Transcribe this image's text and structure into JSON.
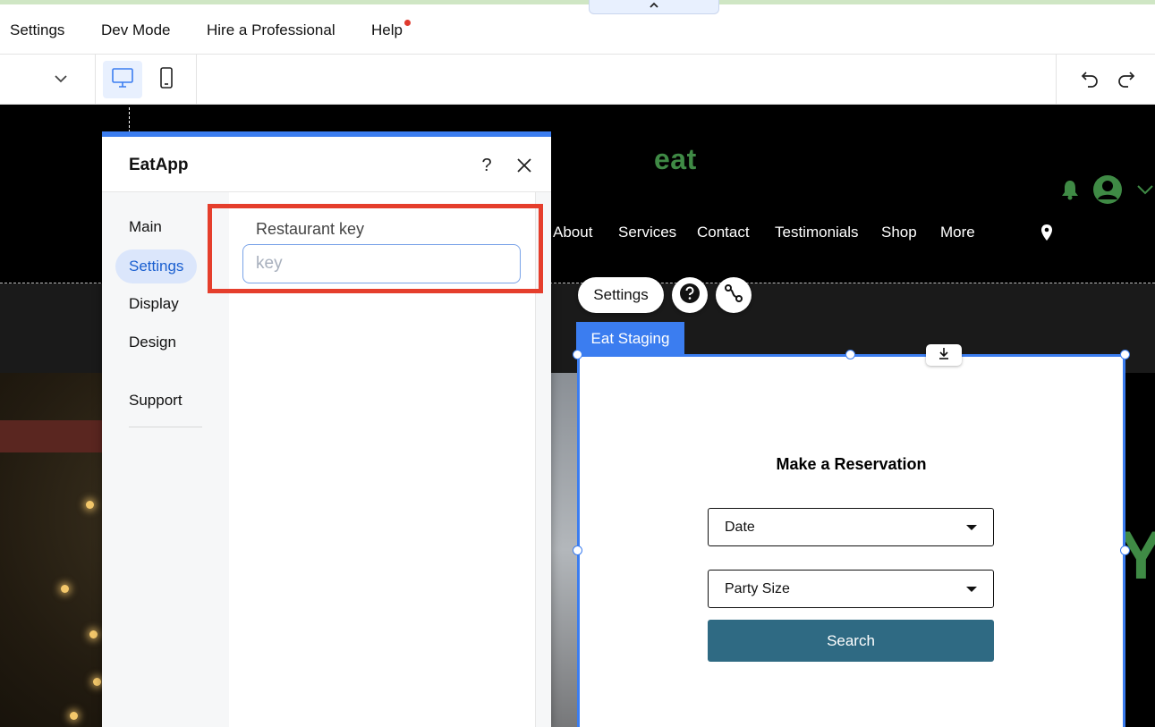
{
  "menubar": {
    "items": [
      "Settings",
      "Dev Mode",
      "Hire a Professional",
      "Help"
    ],
    "help_notification": true
  },
  "collapse_tab": {
    "icon": "chevron-up-icon",
    "glyph": "⌃"
  },
  "toolbar": {
    "dropdown_icon": "chevron-down-icon",
    "desktop_icon": "desktop-icon",
    "mobile_icon": "mobile-icon",
    "undo_icon": "undo-icon",
    "redo_icon": "redo-icon",
    "active_view": "desktop"
  },
  "site": {
    "logo": "eat",
    "nav": [
      "About",
      "Services",
      "Contact",
      "Testimonials",
      "Shop",
      "More"
    ],
    "hero_letter": "Y",
    "brand_color": "#3f8a45"
  },
  "widget_controls": {
    "settings_label": "Settings",
    "help_icon": "question-circle-icon",
    "connect_icon": "connect-icon"
  },
  "widget": {
    "tag": "Eat Staging",
    "title": "Make a Reservation",
    "date_label": "Date",
    "party_label": "Party Size",
    "search_label": "Search",
    "button_color": "#2f6a83",
    "selection_color": "#3b7df0"
  },
  "panel": {
    "title": "EatApp",
    "help_glyph": "?",
    "nav": [
      "Main",
      "Settings",
      "Display",
      "Design",
      "Support"
    ],
    "selected_nav": "Settings",
    "field_label": "Restaurant key",
    "field_placeholder": "key",
    "field_value": "",
    "highlight_color": "#e53e2c"
  }
}
